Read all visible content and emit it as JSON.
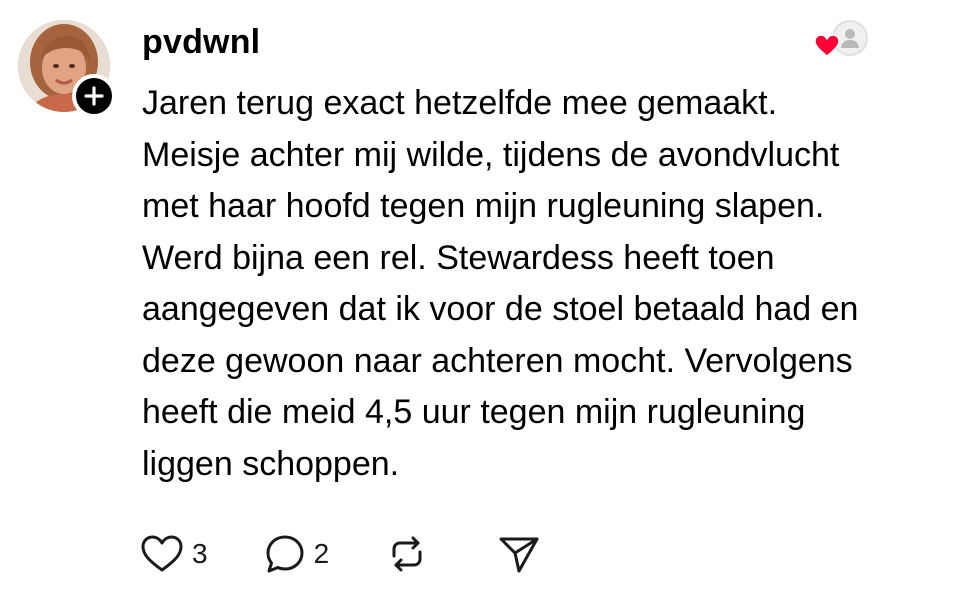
{
  "post": {
    "username": "pvdwnl",
    "text": "Jaren terug exact hetzelfde mee gemaakt.\nMeisje achter mij wilde, tijdens de avondvlucht\nmet haar hoofd tegen mijn rugleuning slapen.\nWerd bijna een rel. Stewardess heeft toen\naangegeven dat ik voor de stoel betaald had en\ndeze gewoon naar achteren mocht. Vervolgens\nheeft die meid 4,5 uur tegen mijn rugleuning\nliggen schoppen.",
    "avatar_icon": "profile-photo",
    "follow_icon": "plus-icon",
    "liked_by_icon": "heart-icon",
    "heart_color": "#ff0034"
  },
  "actions": {
    "like_count": "3",
    "reply_count": "2",
    "like_icon": "heart-outline-icon",
    "reply_icon": "speech-bubble-icon",
    "repost_icon": "repost-icon",
    "share_icon": "paper-plane-icon"
  }
}
